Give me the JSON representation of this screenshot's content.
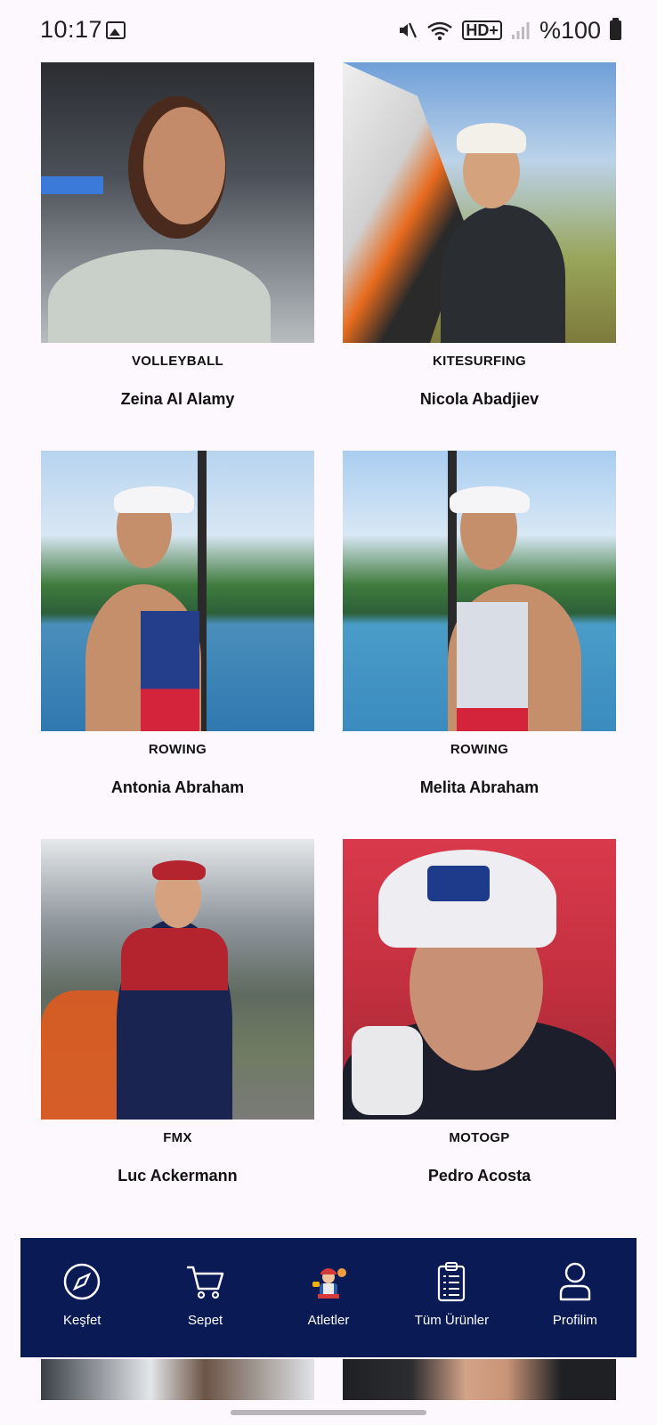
{
  "status_bar": {
    "time": "10:17",
    "battery_text": "%100",
    "network_label": "HD+",
    "icons": [
      "gallery-icon",
      "mute-icon",
      "wifi-icon",
      "hd-plus-icon",
      "signal-icon",
      "battery-icon"
    ]
  },
  "athletes": [
    {
      "sport": "VOLLEYBALL",
      "name": "Zeina Al Alamy"
    },
    {
      "sport": "KITESURFING",
      "name": "Nicola Abadjiev"
    },
    {
      "sport": "ROWING",
      "name": "Antonia Abraham"
    },
    {
      "sport": "ROWING",
      "name": "Melita Abraham"
    },
    {
      "sport": "FMX",
      "name": "Luc Ackermann"
    },
    {
      "sport": "MOTOGP",
      "name": "Pedro Acosta"
    }
  ],
  "bottom_nav": {
    "items": [
      {
        "label": "Keşfet",
        "icon": "compass-icon"
      },
      {
        "label": "Sepet",
        "icon": "cart-icon"
      },
      {
        "label": "Atletler",
        "icon": "athlete-icon"
      },
      {
        "label": "Tüm Ürünler",
        "icon": "clipboard-icon"
      },
      {
        "label": "Profilim",
        "icon": "profile-icon"
      }
    ],
    "background": "#0a1a55",
    "text_color": "#ffffff"
  }
}
